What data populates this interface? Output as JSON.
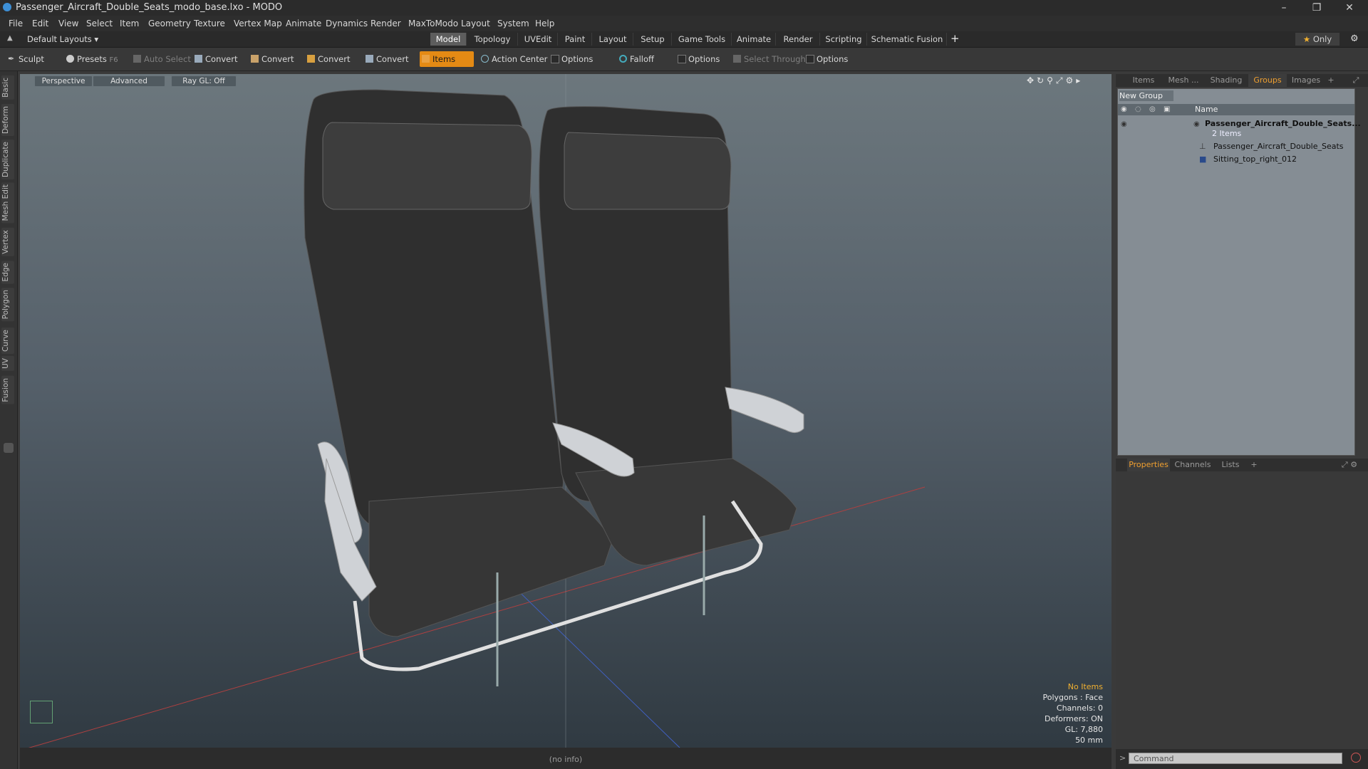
{
  "window": {
    "title": "Passenger_Aircraft_Double_Seats_modo_base.lxo - MODO"
  },
  "menu": [
    "File",
    "Edit",
    "View",
    "Select",
    "Item",
    "Geometry",
    "Texture",
    "Vertex Map",
    "Animate",
    "Dynamics",
    "Render",
    "MaxToModo",
    "Layout",
    "System",
    "Help"
  ],
  "layouts": {
    "dropdown": "Default Layouts",
    "tabs": [
      "Model",
      "Topology",
      "UVEdit",
      "Paint",
      "Layout",
      "Setup",
      "Game Tools",
      "Animate",
      "Render",
      "Scripting",
      "Schematic Fusion"
    ],
    "active": "Model",
    "add": "+",
    "only": "Only"
  },
  "toolbar": {
    "sculpt": "Sculpt",
    "presets": "Presets",
    "presets_key": "F6",
    "auto_select": "Auto Select",
    "convert1": "Convert",
    "convert2": "Convert",
    "convert3": "Convert",
    "convert4": "Convert",
    "items": "Items",
    "action_center": "Action Center",
    "options1": "Options",
    "falloff": "Falloff",
    "options2": "Options",
    "select_through": "Select Through",
    "options3": "Options"
  },
  "left_tabs": [
    "Basic",
    "Deform",
    "Duplicate",
    "Mesh Edit",
    "Vertex",
    "Edge",
    "Polygon",
    "Curve",
    "UV",
    "Fusion"
  ],
  "viewport": {
    "perspective": "Perspective",
    "advanced": "Advanced",
    "raygl": "Ray GL: Off",
    "info": {
      "no_items": "No Items",
      "polygons": "Polygons : Face",
      "channels": "Channels: 0",
      "deformers": "Deformers: ON",
      "gl": "GL: 7,880",
      "scale": "50 mm"
    },
    "status": "(no info)"
  },
  "right_panel": {
    "tabs": [
      "Items",
      "Mesh ...",
      "Shading",
      "Groups",
      "Images"
    ],
    "active_tab": "Groups",
    "add": "+",
    "new_group": "New Group",
    "col_name": "Name",
    "group": {
      "name": "Passenger_Aircraft_Double_Seats...",
      "count": "2 Items",
      "children": [
        "Passenger_Aircraft_Double_Seats",
        "Sitting_top_right_012"
      ]
    },
    "bottom_tabs": [
      "Properties",
      "Channels",
      "Lists"
    ],
    "bottom_active": "Properties",
    "bottom_add": "+"
  },
  "command": {
    "placeholder": "Command",
    "prompt": ">"
  }
}
